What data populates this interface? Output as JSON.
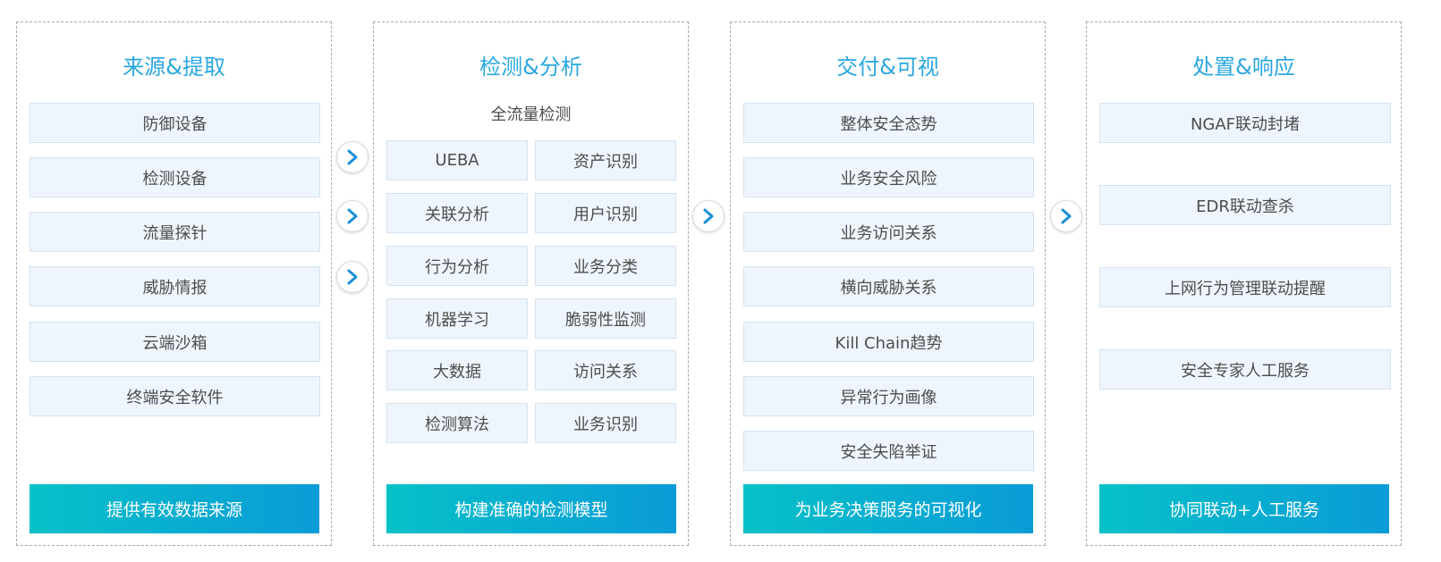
{
  "columns": [
    {
      "title": "来源&提取",
      "items": [
        "防御设备",
        "检测设备",
        "流量探针",
        "威胁情报",
        "云端沙箱",
        "终端安全软件"
      ],
      "footer": "提供有效数据来源"
    },
    {
      "title": "检测&分析",
      "subtitle": "全流量检测",
      "grid": [
        [
          "UEBA",
          "资产识别"
        ],
        [
          "关联分析",
          "用户识别"
        ],
        [
          "行为分析",
          "业务分类"
        ],
        [
          "机器学习",
          "脆弱性监测"
        ],
        [
          "大数据",
          "访问关系"
        ],
        [
          "检测算法",
          "业务识别"
        ]
      ],
      "footer": "构建准确的检测模型"
    },
    {
      "title": "交付&可视",
      "items": [
        "整体安全态势",
        "业务安全风险",
        "业务访问关系",
        "横向威胁关系",
        "Kill Chain趋势",
        "异常行为画像",
        "安全失陷举证"
      ],
      "footer": "为业务决策服务的可视化"
    },
    {
      "title": "处置&响应",
      "items": [
        "NGAF联动封堵",
        "EDR联动查杀",
        "上网行为管理联动提醒",
        "安全专家人工服务"
      ],
      "footer": "协同联动+人工服务"
    }
  ],
  "icons": {
    "arrow": "chevron-right-icon"
  },
  "colors": {
    "title": "#2ba7df",
    "box_bg": "#eef5fc",
    "box_border": "#d4e3f2",
    "footer_start": "#06c1c8",
    "footer_end": "#0a9bd7",
    "arrow": "#1a8ed6"
  }
}
